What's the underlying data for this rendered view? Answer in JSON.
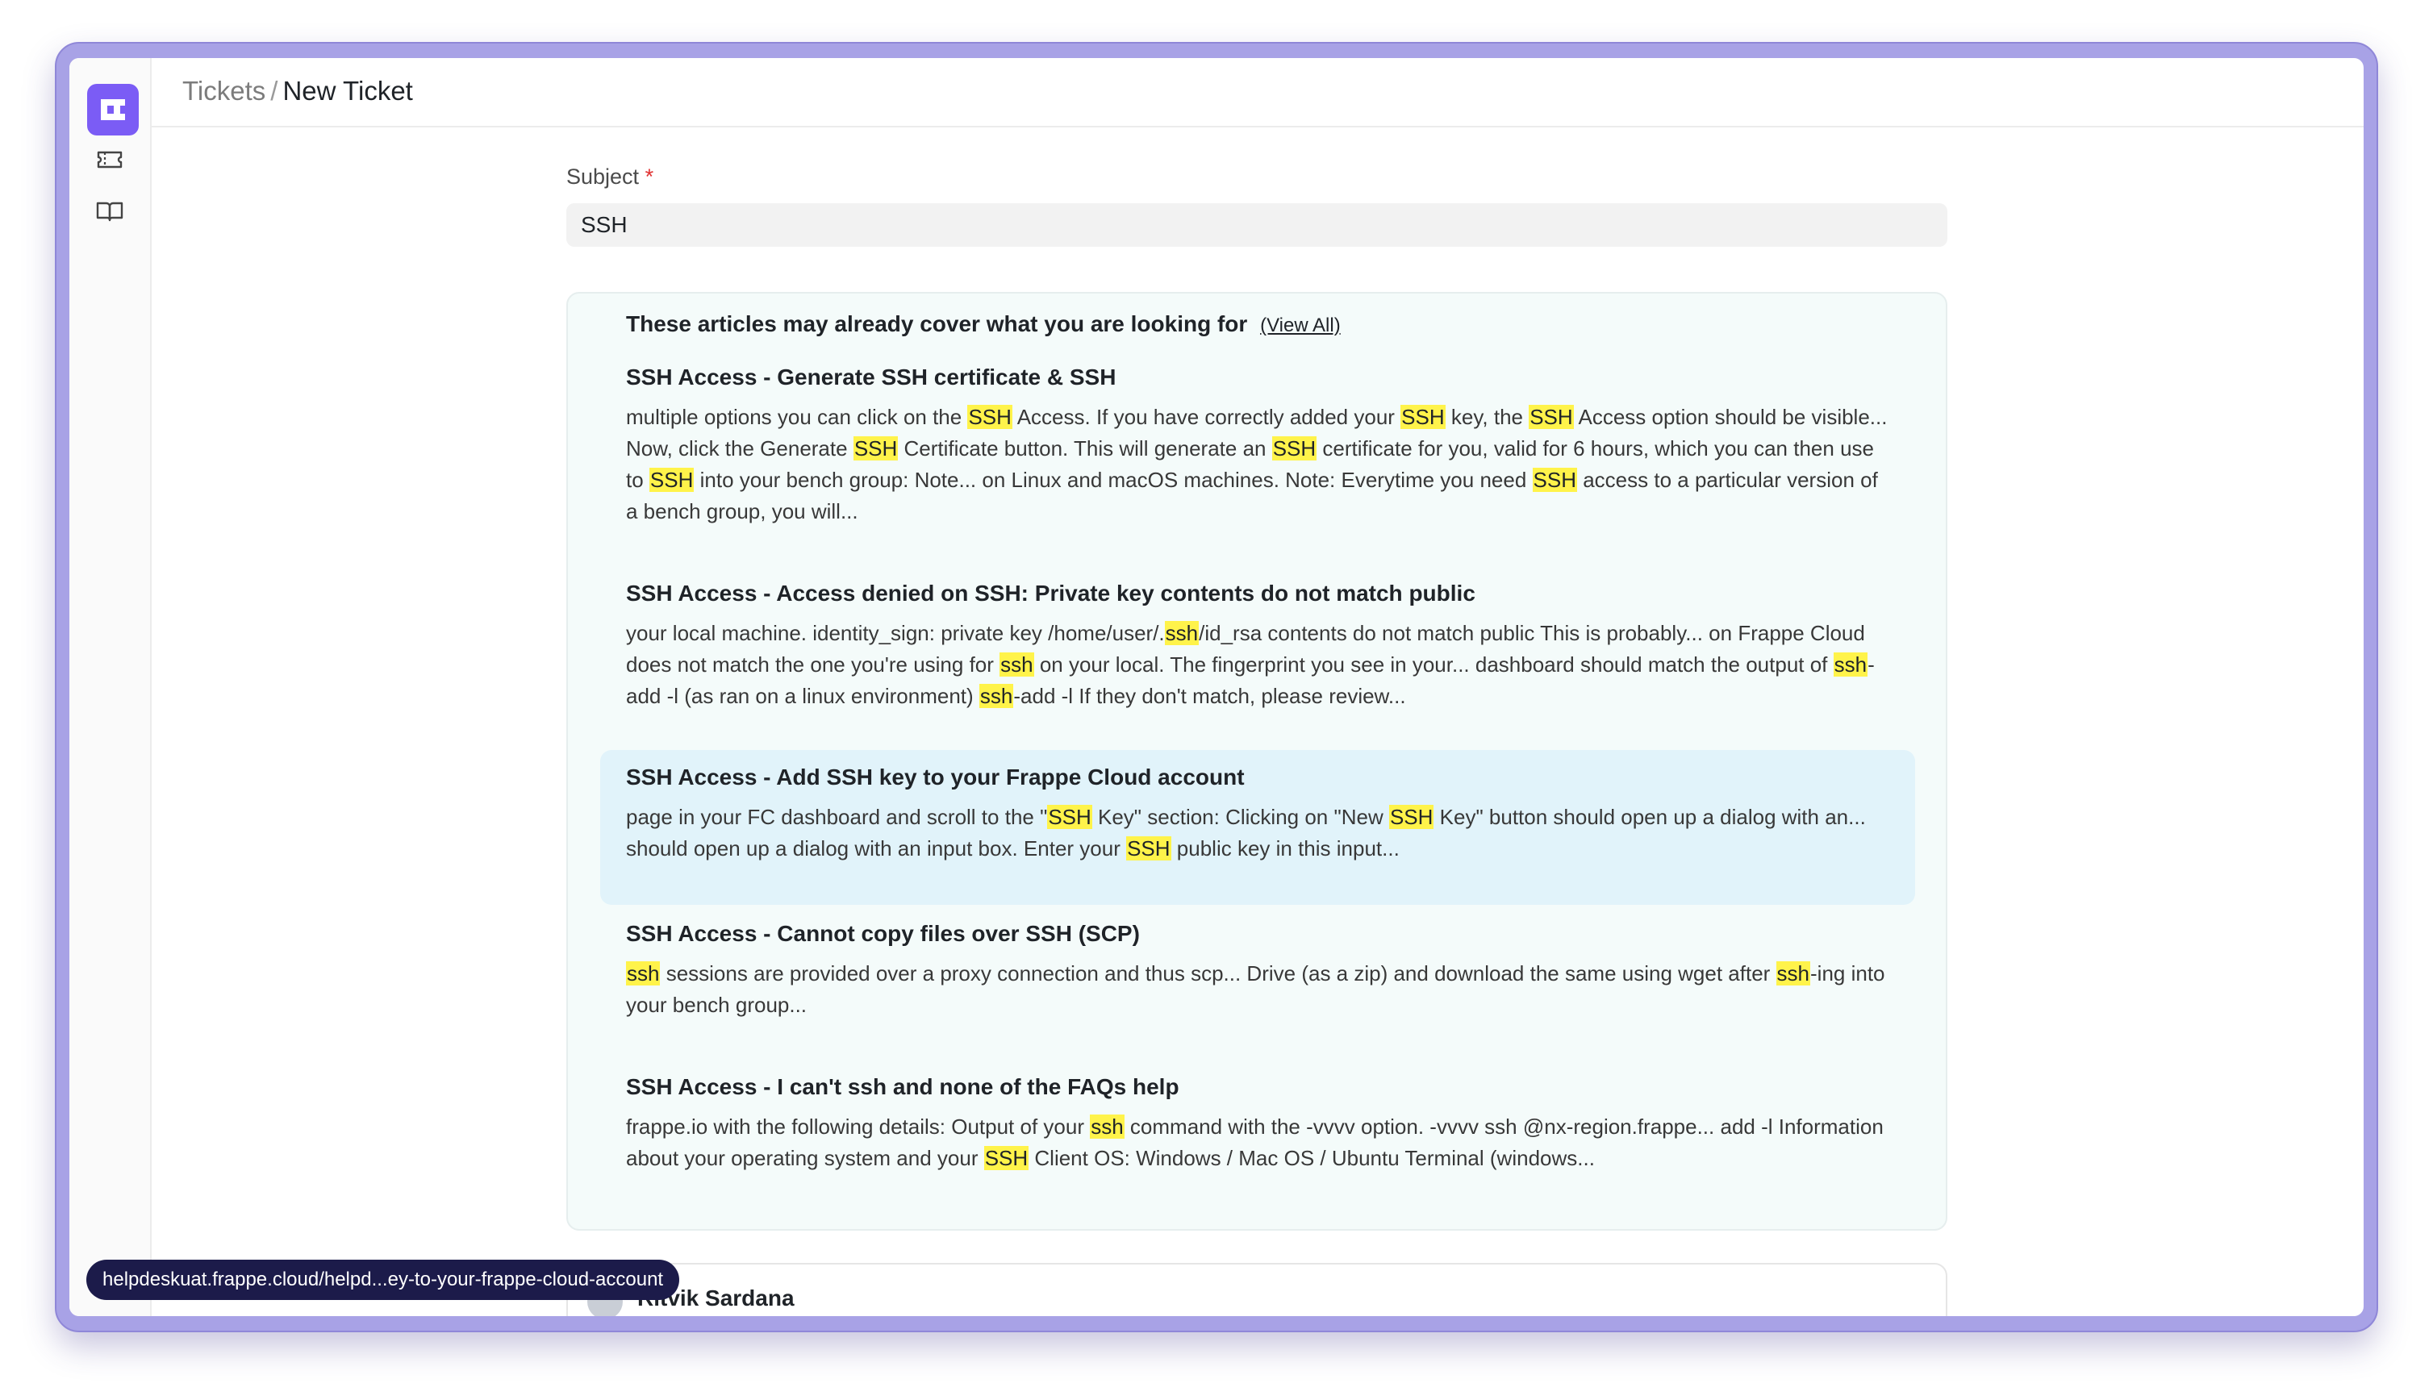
{
  "app": {
    "logo": "helpdesk-logo",
    "nav": [
      {
        "icon": "ticket-icon",
        "name": "Tickets"
      },
      {
        "icon": "book-icon",
        "name": "Knowledge Base"
      }
    ]
  },
  "breadcrumb": {
    "parent": "Tickets",
    "separator": "/",
    "current": "New Ticket"
  },
  "form": {
    "subject_label": "Subject",
    "required_mark": "*",
    "subject_value": "SSH"
  },
  "articles": {
    "heading": "These articles may already cover what you are looking for",
    "view_all_label": "(View All)",
    "items": [
      {
        "title": "SSH Access - Generate SSH certificate & SSH",
        "snippet_html": "multiple options you can click on the <mark>SSH</mark> Access. If you have correctly added your <mark>SSH</mark> key, the <mark>SSH</mark> Access option should be visible... Now, click the Generate <mark>SSH</mark> Certificate button. This will generate an <mark>SSH</mark> certificate for you, valid for 6 hours, which you can then use to <mark>SSH</mark> into your bench group: Note... on Linux and macOS machines. Note: Everytime you need <mark>SSH</mark> access to a particular version of a bench group, you will..."
      },
      {
        "title": "SSH Access - Access denied on SSH: Private key contents do not match public",
        "snippet_html": "your local machine. identity_sign: private key /home/user/.<mark>ssh</mark>/id_rsa contents do not match public This is probably... on Frappe Cloud does not match the one you're using for <mark>ssh</mark> on your local. The fingerprint you see in your... dashboard should match the output of <mark>ssh</mark>-add -l (as ran on a linux environment) <mark>ssh</mark>-add -l If they don't match, please review..."
      },
      {
        "title": "SSH Access - Add SSH key to your Frappe Cloud account",
        "snippet_html": "page in your FC dashboard and scroll to the \"<mark>SSH</mark> Key\" section: Clicking on \"New <mark>SSH</mark> Key\" button should open up a dialog with an... should open up a dialog with an input box. Enter your <mark>SSH</mark> public key in this input..."
      },
      {
        "title": "SSH Access - Cannot copy files over SSH (SCP)",
        "snippet_html": "<mark>ssh</mark> sessions are provided over a proxy connection and thus scp... Drive (as a zip) and download the same using wget after <mark>ssh</mark>-ing into your bench group..."
      },
      {
        "title": "SSH Access - I can't ssh and none of the FAQs help",
        "snippet_html": "frappe.io with the following details: Output of your <mark>ssh</mark> command with the -vvvv option. -vvvv ssh @nx-region.frappe... add -l Information about your operating system and your <mark>SSH</mark> Client OS: Windows / Mac OS / Ubuntu Terminal (windows..."
      }
    ]
  },
  "reply": {
    "author": "Ritvik Sardana"
  },
  "status_bar_url": "helpdeskuat.frappe.cloud/helpd...ey-to-your-frappe-cloud-account",
  "colors": {
    "accent": "#7b5cf5",
    "highlight": "#fff34a",
    "article_hover": "#e1f3fa",
    "window_frame": "#a8a2e6"
  }
}
